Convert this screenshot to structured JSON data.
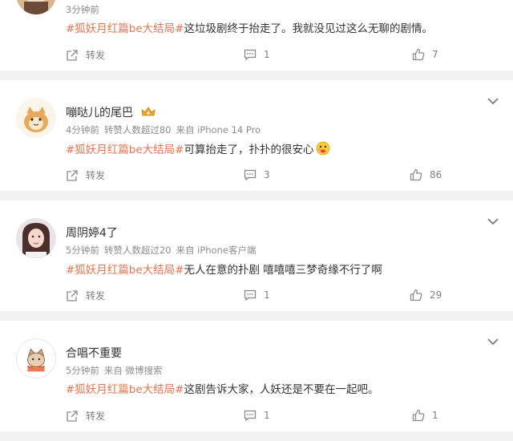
{
  "comments": [
    {
      "time": "3分钟前",
      "tag": "#狐妖月红篇be大结局#",
      "text": "这垃圾剧终于抬走了。我就没见过这么无聊的剧情。",
      "repost_label": "转发",
      "reply_count": "1",
      "like_count": "7"
    },
    {
      "username": "嘣哒儿的尾巴",
      "time": "4分钟前",
      "reposts": "转赞人数超过80",
      "source": "来自 iPhone 14 Pro",
      "tag": "#狐妖月红篇be大结局#",
      "text": "可算抬走了，扑扑的很安心",
      "repost_label": "转发",
      "reply_count": "3",
      "like_count": "86"
    },
    {
      "username": "周阴婷4了",
      "time": "5分钟前",
      "reposts": "转赞人数超过20",
      "source": "来自 iPhone客户端",
      "tag": "#狐妖月红篇be大结局#",
      "text": "无人在意的扑剧 嘻嘻嘻三梦奇缘不行了啊",
      "repost_label": "转发",
      "reply_count": "1",
      "like_count": "29"
    },
    {
      "username": "合唱不重要",
      "time": "5分钟前",
      "source": "来自 微博搜索",
      "tag": "#狐妖月红篇be大结局#",
      "text": "这剧告诉大家，人妖还是不要在一起吧。",
      "repost_label": "转发",
      "reply_count": "1",
      "like_count": "1"
    }
  ],
  "colors": {
    "tag": "#eb7350",
    "meta": "#8c8c8c",
    "background": "#f2f2f2"
  },
  "icons": [
    "share-icon",
    "comment-icon",
    "like-icon",
    "chevron-down-icon",
    "vip-badge-icon",
    "emoji-face-icon"
  ]
}
